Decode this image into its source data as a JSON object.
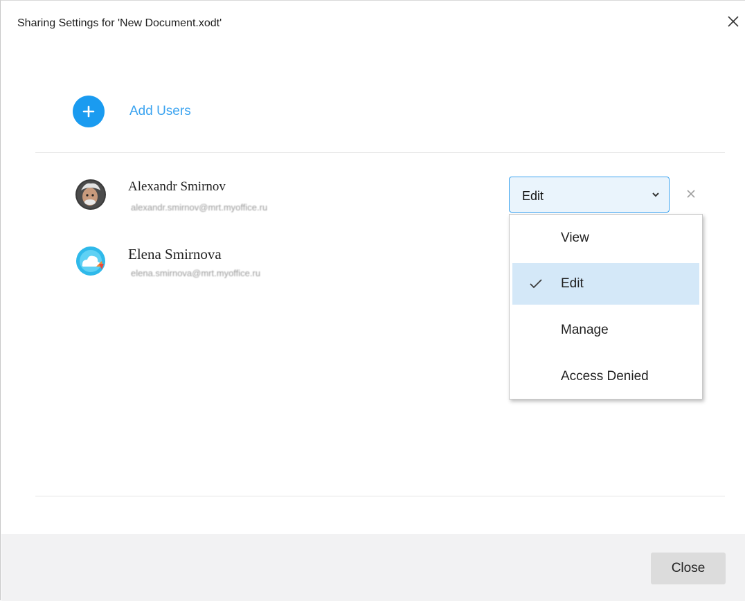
{
  "window": {
    "title": "Sharing Settings for 'New Document.xodt'"
  },
  "add_users": {
    "label": "Add Users"
  },
  "users": [
    {
      "name": "Alexandr Smirnov",
      "email": "alexandr.smirnov@mrt.myoffice.ru",
      "access": "Edit"
    },
    {
      "name": "Elena Smirnova",
      "email": "elena.smirnova@mrt.myoffice.ru"
    }
  ],
  "access_menu": {
    "options": [
      "View",
      "Edit",
      "Manage",
      "Access Denied"
    ],
    "selected": "Edit"
  },
  "footer": {
    "close_label": "Close"
  },
  "colors": {
    "accent": "#1a9bf0",
    "link": "#3aa3f0",
    "selected_bg": "#d4e8f8",
    "footer_bg": "#f2f2f3"
  }
}
